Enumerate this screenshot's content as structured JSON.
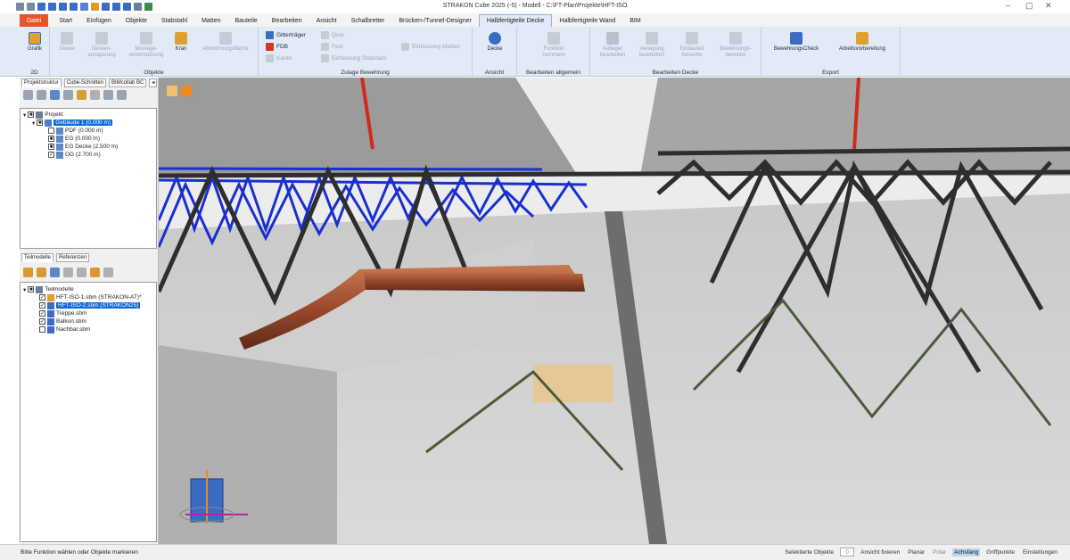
{
  "window": {
    "title": "STRAKON Cube 2025 (-5) - Modell - C:\\FT-Plan\\Projekte\\HFT-ISO",
    "minimize": "–",
    "maximize": "▢",
    "close": "✕"
  },
  "tabs": [
    "Datei",
    "Start",
    "Einfügen",
    "Objekte",
    "Stabstahl",
    "Matten",
    "Bauteile",
    "Bearbeiten",
    "Ansicht",
    "Schalbretter",
    "Brücken-/Tunnel-Designer",
    "Halbfertigteile Decke",
    "Halbfertigteile Wand",
    "BIM"
  ],
  "active_tab": "Halbfertigteile Decke",
  "ribbon": {
    "g2d": {
      "label": "2D",
      "grafik": "Grafik"
    },
    "objekte": {
      "label": "Objekte",
      "decke": "Decke",
      "aussparung": "Decken-\naussparung",
      "montage": "Montage-\nwinterstützung",
      "kran": "Kran",
      "abrechnung": "Abrechnungsfläche"
    },
    "zulage": {
      "label": "Zulage Bewehrung",
      "gitter": "Gitterträger",
      "fdb": "FDB",
      "kante": "Kante",
      "quer": "Quer",
      "fest": "Fest",
      "einf_stab": "Einfassung Stabstahl",
      "einf_matten": "Einfassung Matten"
    },
    "ansicht": {
      "label": "Ansicht",
      "decke": "Decke"
    },
    "bearb_allg": {
      "label": "Bearbeiten allgemein",
      "funktion": "Funktion\nnummern"
    },
    "bearb_decke": {
      "label": "Bearbeiten Decke",
      "auflager": "Auflager\nbearbeiten",
      "betonieren": "Verlegung\nbearbeiten",
      "einbau": "Einbauteil\nbereiche",
      "bewehrung": "Bewehrungs-\nbereiche"
    },
    "export": {
      "label": "Export",
      "check": "BewehrungsCheck",
      "arbeit": "Arbeitsvorbereitung"
    }
  },
  "panel_top": {
    "tabs": [
      "Projektstruktur",
      "Cube-Schnitten",
      "BIMcollab BC"
    ],
    "nodes": [
      "Projekt",
      "Gebäude 1 (0.000 m)",
      "PDF (0.000 m)",
      "EG (0.000 m)",
      "EG Decke (2.500 m)",
      "OG (2.700 m)"
    ]
  },
  "panel_bottom": {
    "tabs": [
      "Teilmodelle",
      "Referenzen"
    ],
    "nodes": [
      "Teilmodelle",
      "HFT-ISO-1.sbm (STRAKON-AT)*",
      "HFT-ISO-2.sbm (STRAKON25)",
      "Treppe.sbm",
      "Balkon.sbm",
      "Nachbar.sbm"
    ]
  },
  "status": {
    "message": "Bitte Funktion wählen oder Objekte markieren",
    "selected_label": "Selektierte Objekte",
    "selected_count": "0",
    "items": [
      "Ansicht fixieren",
      "Planar",
      "Polar",
      "Achsfang",
      "Griffpunkte",
      "Einstellungen"
    ],
    "active_item": "Achsfang"
  },
  "colors": {
    "file_tab": "#e8542a",
    "ribbon": "#e1eaf6",
    "selection": "#0a6ad8",
    "rebar_blue": "#1a2fd0",
    "rebar_dark": "#2e2e2e",
    "rebar_rust": "#9c4a2c"
  }
}
